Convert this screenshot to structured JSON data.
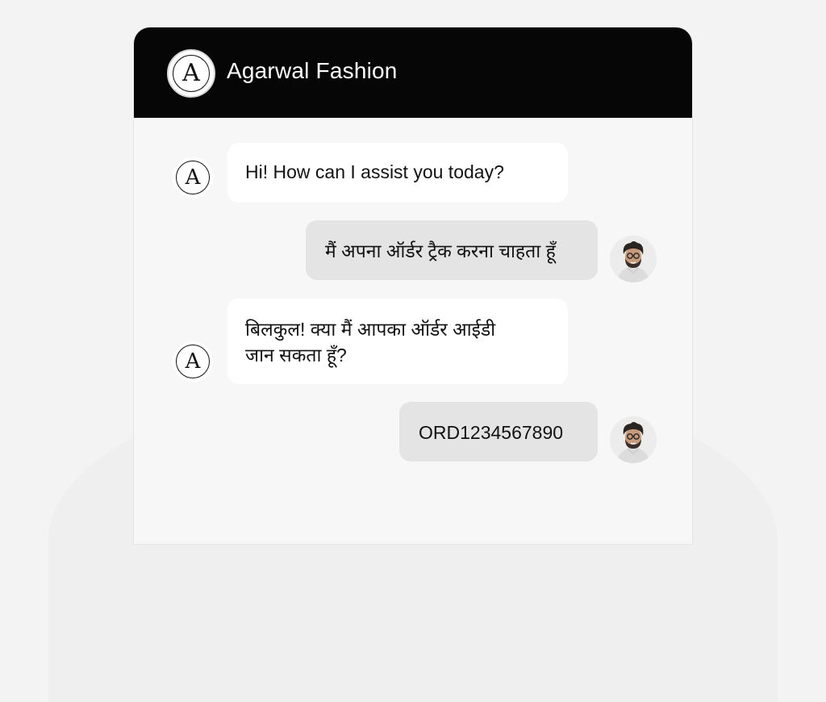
{
  "app": {
    "brand_name": "Agarwal Fashion",
    "logo_letter": "A",
    "colors": {
      "header_bg": "#060607",
      "bot_bubble": "#ffffff",
      "user_bubble": "#e4e4e4",
      "page_bg": "#f3f3f3"
    }
  },
  "messages": [
    {
      "sender": "bot",
      "avatar": "brand-logo-icon",
      "text": "Hi! How can I assist you today?"
    },
    {
      "sender": "user",
      "avatar": "user-photo",
      "text": "मैं अपना ऑर्डर ट्रैक करना चाहता हूँ"
    },
    {
      "sender": "bot",
      "avatar": "brand-logo-icon",
      "line1": "बिलकुल! क्या मैं आपका ऑर्डर आईडी",
      "line2": "जान सकता हूँ?"
    },
    {
      "sender": "user",
      "avatar": "user-photo",
      "text": "ORD1234567890"
    }
  ]
}
